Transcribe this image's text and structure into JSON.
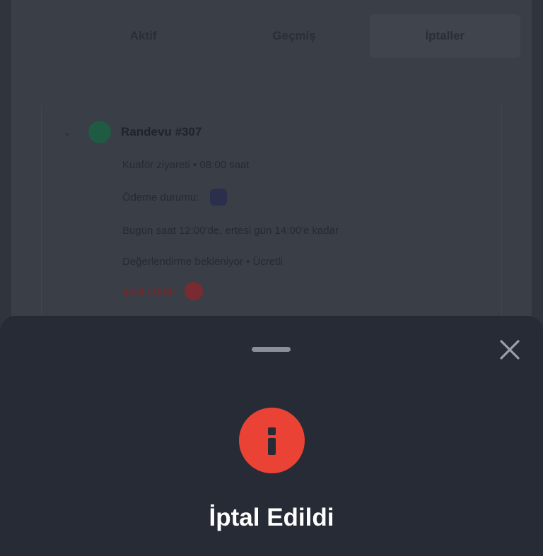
{
  "background": {
    "tabs": [
      {
        "label": "Aktif",
        "active": false
      },
      {
        "label": "Geçmiş",
        "active": false
      },
      {
        "label": "İptaller",
        "active": true
      }
    ],
    "card": {
      "title": "Randevu #307",
      "rows": [
        {
          "label": "Kuaför ziyareti • 08:00 saat"
        },
        {
          "label": "Ödeme durumu:"
        },
        {
          "label": "Bugün saat 12:00'de, ertesi gün 14:00'e kadar"
        },
        {
          "label": "Değerlendirme bekleniyor • Ücretli"
        },
        {
          "label": "İptal edildi"
        }
      ]
    }
  },
  "sheet": {
    "title": "İptal Edildi",
    "accent_color": "#ea4335",
    "icons": {
      "close": "close-icon",
      "status": "info-icon"
    }
  }
}
